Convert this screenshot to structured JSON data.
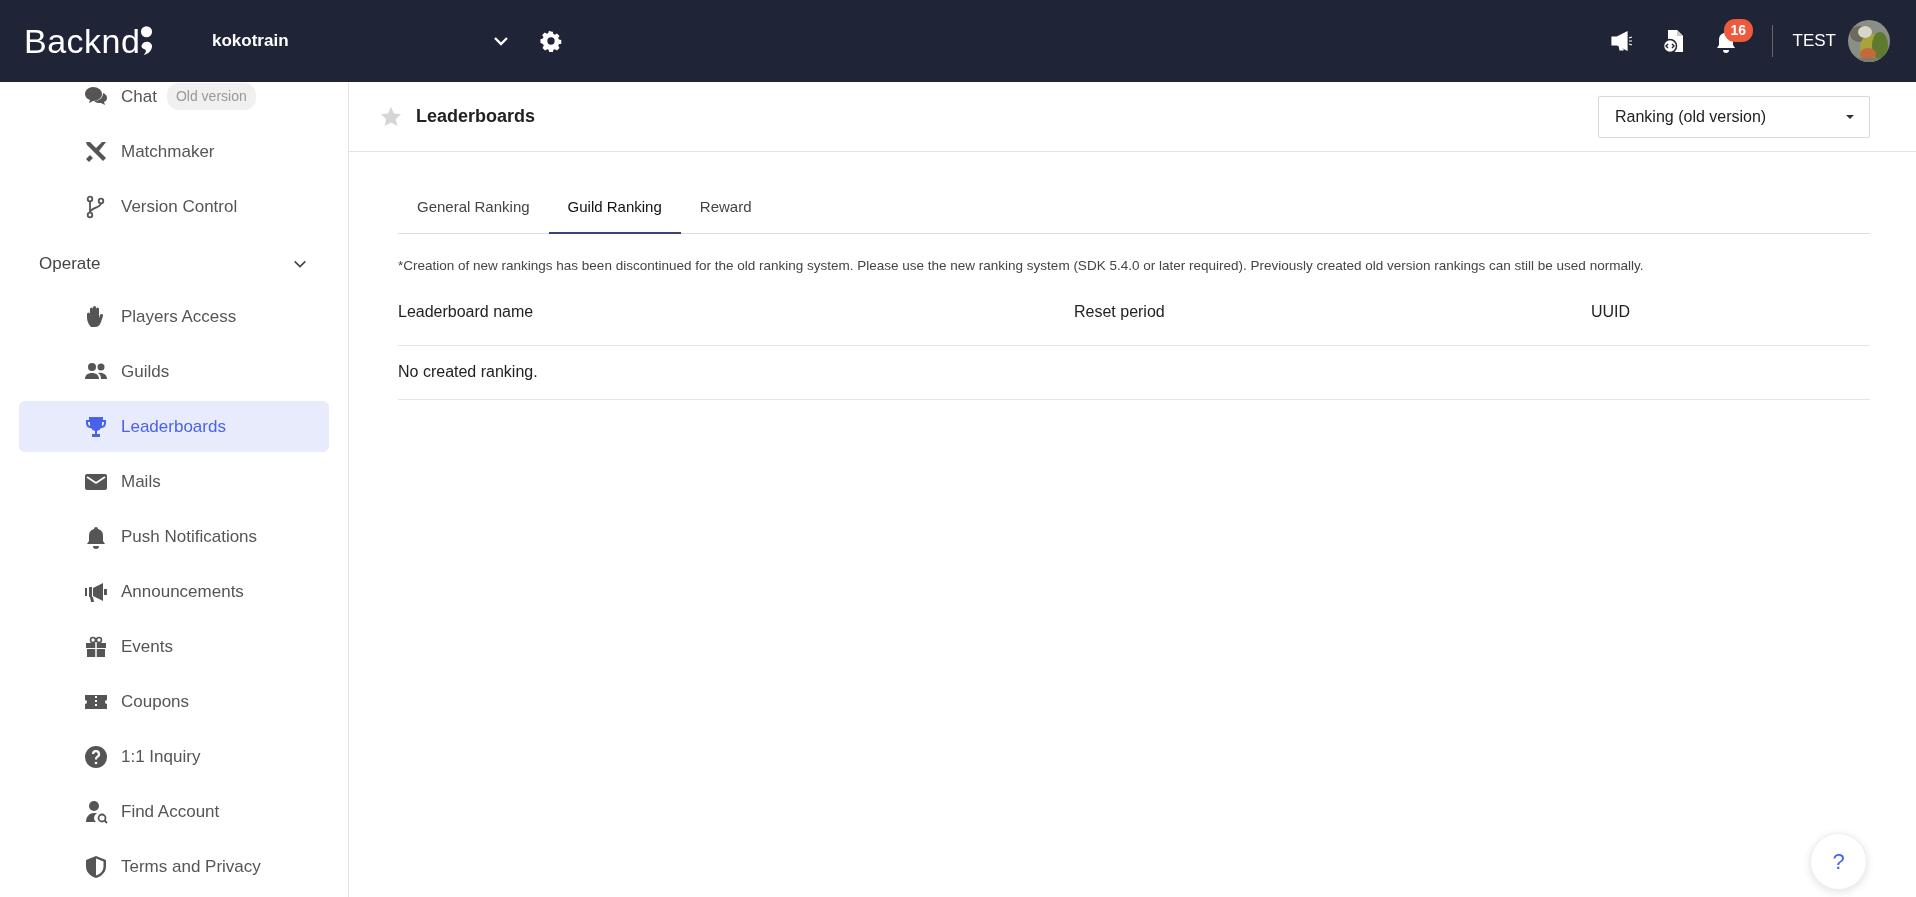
{
  "header": {
    "logo": "Backnd",
    "project": "kokotrain",
    "user": "TEST",
    "notification_count": "16"
  },
  "sidebar": {
    "items": [
      {
        "kind": "item",
        "label": "Chat",
        "badge": "Old version",
        "selected": false
      },
      {
        "kind": "item",
        "label": "Matchmaker",
        "selected": false
      },
      {
        "kind": "item",
        "label": "Version Control",
        "selected": false
      },
      {
        "kind": "section",
        "label": "Operate",
        "expanded": true,
        "children": [
          {
            "kind": "item",
            "label": "Players Access",
            "selected": false
          },
          {
            "kind": "item",
            "label": "Guilds",
            "selected": false
          },
          {
            "kind": "item",
            "label": "Leaderboards",
            "selected": true
          },
          {
            "kind": "item",
            "label": "Mails",
            "selected": false
          },
          {
            "kind": "item",
            "label": "Push Notifications",
            "selected": false
          },
          {
            "kind": "item",
            "label": "Announcements",
            "selected": false
          },
          {
            "kind": "item",
            "label": "Events",
            "selected": false
          },
          {
            "kind": "item",
            "label": "Coupons",
            "selected": false
          },
          {
            "kind": "item",
            "label": "1:1 Inquiry",
            "selected": false
          },
          {
            "kind": "item",
            "label": "Find Account",
            "selected": false
          },
          {
            "kind": "item",
            "label": "Terms and Privacy",
            "selected": false
          }
        ]
      }
    ]
  },
  "page": {
    "title": "Leaderboards",
    "starred": false,
    "version_select": {
      "value": "Ranking (old version)"
    }
  },
  "tabs": [
    {
      "label": "General Ranking",
      "selected": false
    },
    {
      "label": "Guild Ranking",
      "selected": true
    },
    {
      "label": "Reward",
      "selected": false
    }
  ],
  "notice": "*Creation of new rankings has been discontinued for the old ranking system. Please use the new ranking system (SDK 5.4.0 or later required). Previously created old version rankings can still be used normally.",
  "table": {
    "columns": [
      "Leaderboard name",
      "Reset period",
      "UUID"
    ],
    "empty_message": "No created ranking."
  },
  "help_button": {
    "label": "?"
  }
}
